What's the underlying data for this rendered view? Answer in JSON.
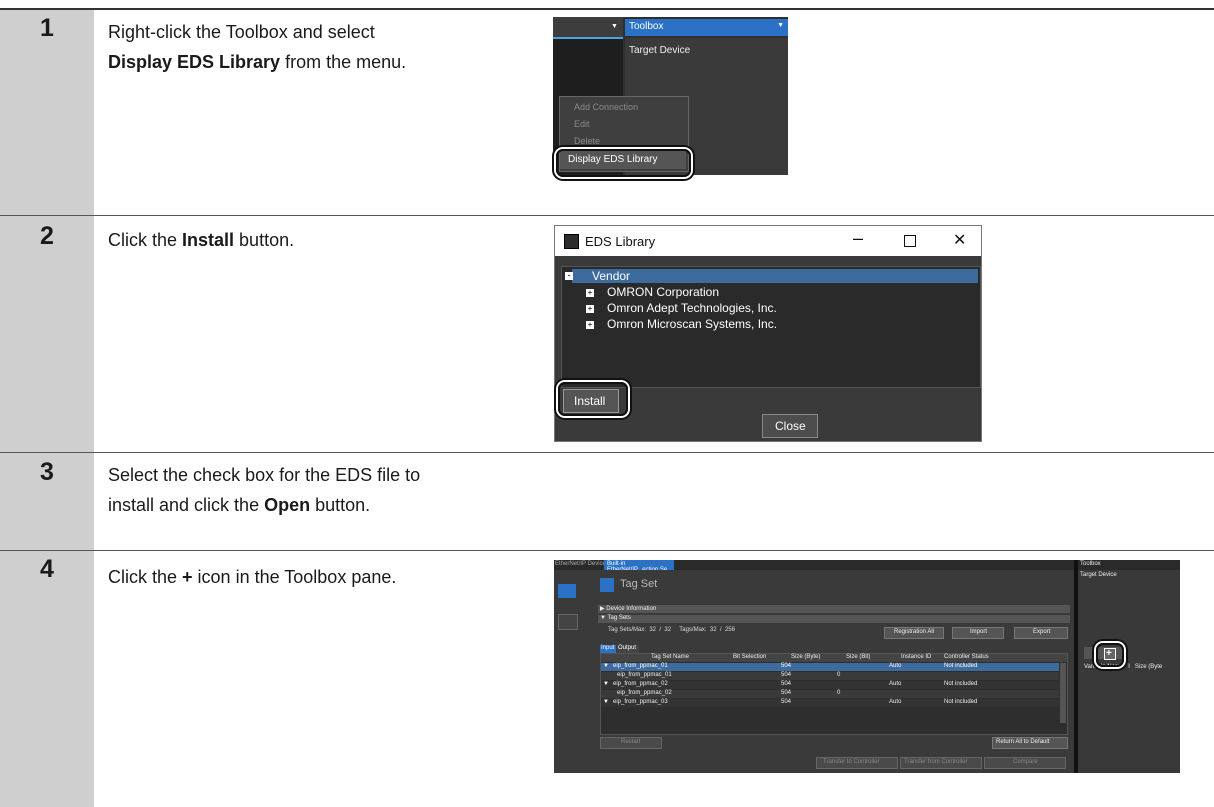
{
  "steps": [
    {
      "number": "1",
      "text_before": "Right-click the Toolbox and select",
      "bold": "Display EDS Library",
      "text_after": " from the menu."
    },
    {
      "number": "2",
      "text_before": "Click the ",
      "bold": "Install",
      "text_after": " button."
    },
    {
      "number": "3",
      "text_before": "Select the check box for the EDS file to",
      "text_line2_before": "install and click the ",
      "bold": "Open",
      "text_after": " button."
    },
    {
      "number": "4",
      "text_before": "Click the ",
      "bold": "+",
      "text_after": " icon in the Toolbox pane."
    }
  ],
  "shot1": {
    "toolbox_title": "Toolbox",
    "target_device": "Target Device",
    "menu_items": [
      "Add Connection",
      "Edit",
      "Delete"
    ],
    "menu_highlight": "Display EDS Library"
  },
  "shot2": {
    "window_title": "EDS Library",
    "tree_root": "Vendor",
    "vendors": [
      "OMRON Corporation",
      "Omron Adept Technologies, Inc.",
      "Omron Microscan Systems, Inc."
    ],
    "install_label": "Install",
    "close_label": "Close"
  },
  "shot4": {
    "tabs": [
      "EtherNet/IP Device List",
      "Built-in EtherNet/IP...ection Se..."
    ],
    "title": "Tag Set",
    "sections": [
      "Device Information",
      "Tag Sets"
    ],
    "counts": "Tag Sets/Max:  32  /  32     Tags/Max:  32  /  256",
    "buttons": [
      "Registration All",
      "Import",
      "Export"
    ],
    "io_tabs": [
      "Input",
      "Output"
    ],
    "columns": [
      "Tag Set Name",
      "Bit Selection",
      "Size (Byte)",
      "Size (Bit)",
      "Instance ID",
      "Controller Status"
    ],
    "rows": [
      {
        "name": "eip_from_ppmac_01",
        "size": "504",
        "bit": "",
        "id": "Auto",
        "status": "Not included",
        "expand": "▼"
      },
      {
        "name": "eip_from_ppmac_01",
        "size": "504",
        "bit": "0",
        "id": "",
        "status": "",
        "expand": ""
      },
      {
        "name": "eip_from_ppmac_02",
        "size": "504",
        "bit": "",
        "id": "Auto",
        "status": "Not included",
        "expand": "▼"
      },
      {
        "name": "eip_from_ppmac_02",
        "size": "504",
        "bit": "0",
        "id": "",
        "status": "",
        "expand": ""
      },
      {
        "name": "eip_from_ppmac_03",
        "size": "504",
        "bit": "",
        "id": "Auto",
        "status": "Not included",
        "expand": "▼"
      }
    ],
    "restart": "Restart",
    "return_all": "Return All to Default",
    "bottom_buttons": [
      "Transfer to Controller",
      "Transfer from Controller",
      "Compare"
    ],
    "toolbox_title": "Toolbox",
    "target_device": "Target Device",
    "plus": "+",
    "var_header": "Variable Name   I   Size (Byte"
  }
}
